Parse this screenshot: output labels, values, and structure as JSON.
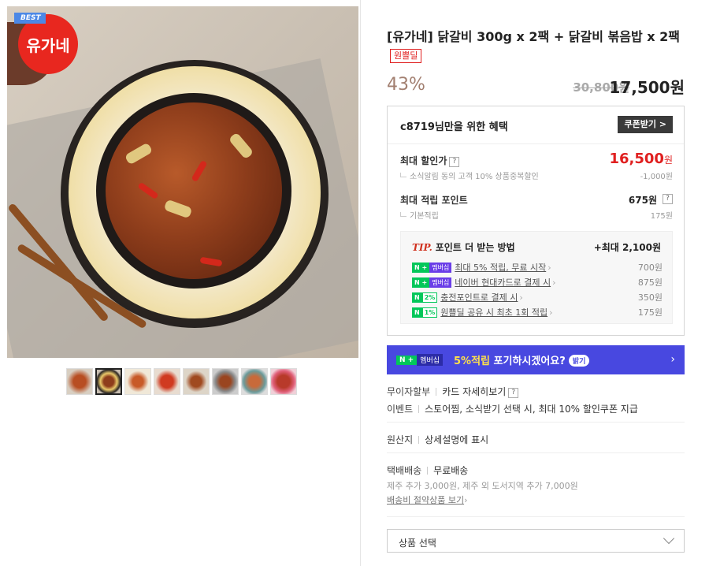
{
  "image": {
    "best_tag": "BEST",
    "logo_text": "유가네"
  },
  "thumbnails": [
    "thumb-1",
    "thumb-2",
    "thumb-3",
    "thumb-4",
    "thumb-5",
    "thumb-6",
    "thumb-7",
    "thumb-8"
  ],
  "product": {
    "title": "[유가네] 닭갈비 300g x 2팩 + 닭갈비 볶음밥 x 2팩",
    "tag": "원쁠딜",
    "discount": "43%",
    "original_price": "30,800원",
    "sale_price": "17,500원"
  },
  "benefit": {
    "title": "c8719님만을 위한 혜택",
    "coupon_button": "쿠폰받기 >",
    "max_discount_label": "최대 할인가",
    "max_discount_value": "16,500",
    "max_discount_unit": "원",
    "max_discount_sub": "소식알림 동의 고객 10% 상품중복할인",
    "max_discount_sub_value": "-1,000원",
    "points_label": "최대 적립 포인트",
    "points_value": "675원",
    "points_sub": "기본적립",
    "points_sub_value": "175원",
    "qmark": "?"
  },
  "tip": {
    "tip_word": "TIP.",
    "heading": "포인트 더 받는 방법",
    "max": "+최대 2,100원",
    "rows": [
      {
        "badge": "멤버십",
        "text": "최대 5% 적립, 무료 시작",
        "value": "700원"
      },
      {
        "badge": "멤버십",
        "text": "네이버 현대카드로 결제 시",
        "value": "875원"
      },
      {
        "badge": "2%",
        "text": "충전포인트로 결제 시",
        "value": "350원"
      },
      {
        "badge": "1%",
        "text": "원쁠딜 공유 시 최초 1회 적립",
        "value": "175원"
      }
    ],
    "n_label": "N",
    "plus": "+"
  },
  "banner": {
    "n_label": "N +",
    "membership": "멤버십",
    "highlight": "5%적립",
    "text": "포기하시겠어요?",
    "pill": "밝기",
    "chevron": "›"
  },
  "details": {
    "installment_key": "무이자할부",
    "installment_val": "카드 자세히보기",
    "event_key": "이벤트",
    "event_val": "스토어찜, 소식받기 선택 시, 최대 10% 할인쿠폰 지급",
    "origin_key": "원산지",
    "origin_val": "상세설명에 표시",
    "delivery_key": "택배배송",
    "delivery_val": "무료배송",
    "delivery_extra": "제주 추가 3,000원, 제주 외 도서지역 추가 7,000원",
    "delivery_link": "배송비 절약상품 보기",
    "link_arrow": "›"
  },
  "select": {
    "label": "상품 선택"
  },
  "colors": {
    "accent_red": "#e02020",
    "naver_green": "#03c75a",
    "banner_blue": "#4848e0",
    "discount_tan": "#a27f70"
  }
}
